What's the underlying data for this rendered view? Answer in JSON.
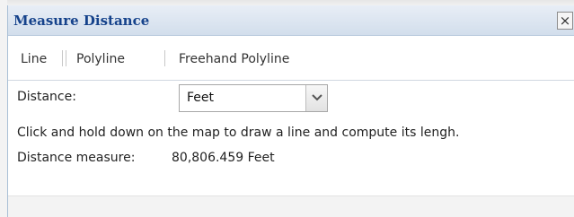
{
  "window": {
    "title": "Measure Distance",
    "close_glyph": "×"
  },
  "tabs": [
    {
      "label": "Line"
    },
    {
      "label": "Polyline"
    },
    {
      "label": "Freehand Polyline"
    }
  ],
  "form": {
    "distance_label": "Distance:",
    "distance_unit_selected": "Feet"
  },
  "instructions": "Click and hold down on the map to draw a line and compute its lengh.",
  "result": {
    "label": "Distance measure:",
    "value": "80,806.459 Feet"
  },
  "icons": {
    "close": "close-icon",
    "dropdown": "chevron-down-icon"
  },
  "colors": {
    "title_text": "#15428b",
    "titlebar_top": "#e8eef6",
    "titlebar_bottom": "#d2deec"
  }
}
